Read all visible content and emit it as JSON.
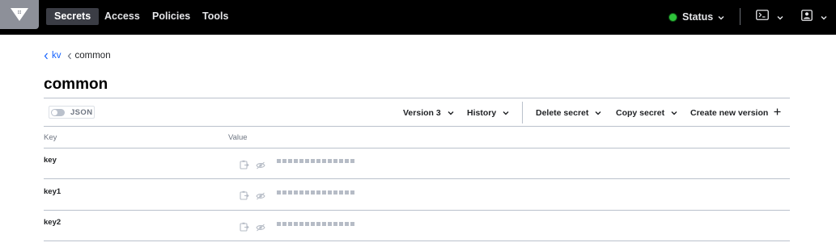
{
  "nav": {
    "logo": "vault-logo-icon",
    "items": [
      {
        "label": "Secrets",
        "active": true
      },
      {
        "label": "Access",
        "active": false
      },
      {
        "label": "Policies",
        "active": false
      },
      {
        "label": "Tools",
        "active": false
      }
    ],
    "status_label": "Status",
    "status_color": "#2ec23a",
    "console_icon": "terminal-icon",
    "user_icon": "user-icon"
  },
  "breadcrumb": {
    "parent": "kv",
    "current": "common"
  },
  "page_title": "common",
  "toolbar": {
    "json_label": "JSON",
    "json_enabled": false,
    "version_label": "Version 3",
    "history_label": "History",
    "delete_label": "Delete secret",
    "copy_label": "Copy secret",
    "create_label": "Create new version"
  },
  "table": {
    "headers": {
      "key": "Key",
      "value": "Value"
    },
    "rows": [
      {
        "key": "key",
        "masked": true
      },
      {
        "key": "key1",
        "masked": true
      },
      {
        "key": "key2",
        "masked": true
      }
    ]
  },
  "colors": {
    "nav_bg": "#000000",
    "link": "#1563ff",
    "border": "#bac1cc"
  }
}
